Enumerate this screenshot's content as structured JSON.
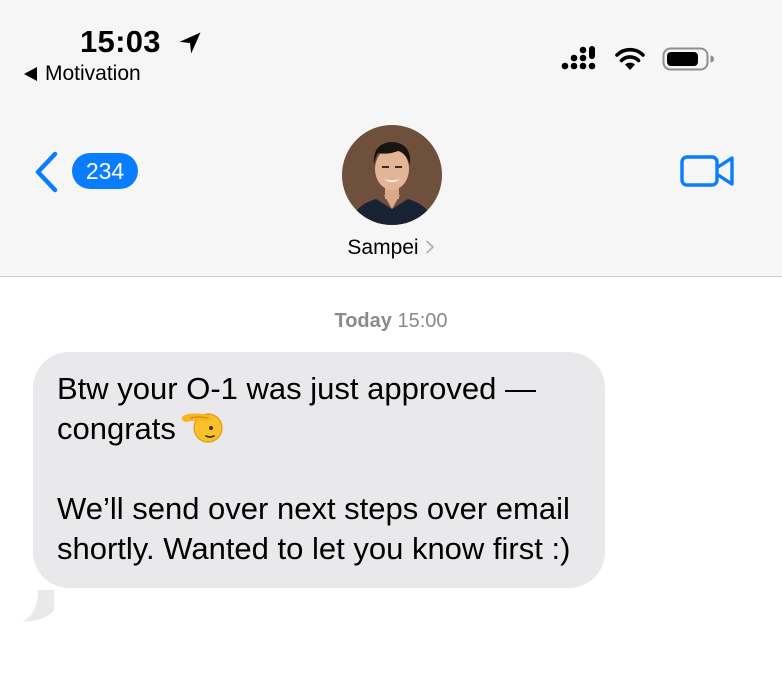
{
  "status_bar": {
    "time": "15:03",
    "back_app": "Motivation",
    "icons": [
      "location-arrow-icon",
      "cellular-signal-icon",
      "wifi-icon",
      "battery-icon"
    ]
  },
  "nav": {
    "unread_count": "234",
    "contact_name": "Sampei",
    "icons": [
      "chevron-left-icon",
      "chevron-right-icon",
      "video-camera-icon"
    ]
  },
  "conversation": {
    "timestamp_day": "Today",
    "timestamp_time": "15:00",
    "message": {
      "paragraph_1": "Btw your O-1 was just approved — congrats",
      "paragraph_1_emoji": "saluting-face-emoji",
      "paragraph_2": "We’ll send over next steps over email shortly. Wanted to let you know first :)"
    }
  },
  "colors": {
    "accent": "#0a7cff",
    "header_bg": "#f6f6f6",
    "bubble_bg": "#e9e9eb",
    "timestamp_text": "#8a8a8e"
  }
}
